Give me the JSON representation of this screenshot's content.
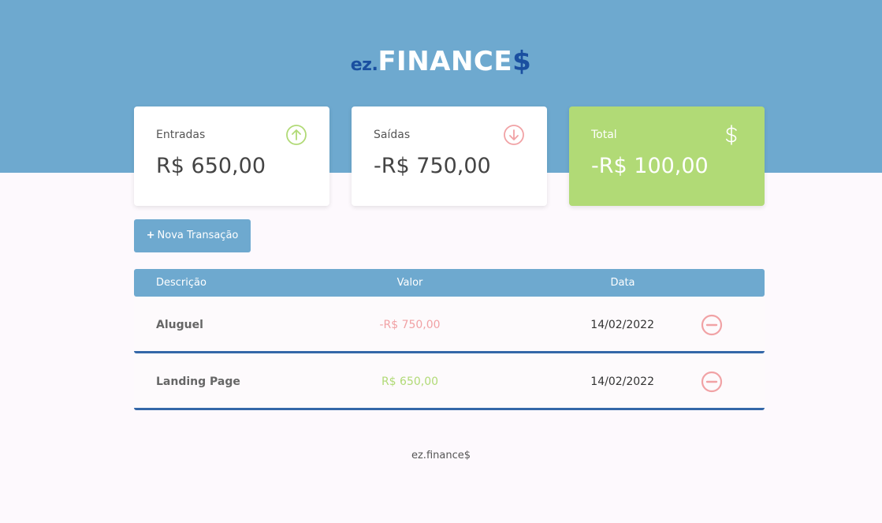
{
  "brand": {
    "prefix": "ez.",
    "name": "FINANCE",
    "suffix": "$"
  },
  "cards": [
    {
      "title": "Entradas",
      "value": "R$ 650,00",
      "icon": "arrow-up-circle-icon",
      "color": "#b1da76"
    },
    {
      "title": "Saídas",
      "value": "-R$ 750,00",
      "icon": "arrow-down-circle-icon",
      "color": "#f1a2a5"
    },
    {
      "title": "Total",
      "value": "-R$ 100,00",
      "icon": "dollar-icon",
      "color": "#ffffff"
    }
  ],
  "new_transaction": {
    "plus": "+",
    "label": "Nova Transação"
  },
  "table": {
    "headers": [
      "Descrição",
      "Valor",
      "Data"
    ],
    "rows": [
      {
        "description": "Aluguel",
        "amount": "-R$ 750,00",
        "date": "14/02/2022",
        "type": "expense"
      },
      {
        "description": "Landing Page",
        "amount": "R$ 650,00",
        "date": "14/02/2022",
        "type": "income"
      }
    ]
  },
  "footer": {
    "text": "ez.finance$"
  },
  "colors": {
    "header_bg": "#6ea9cf",
    "brand_blue": "#1a4fa0",
    "income_green": "#b1da76",
    "expense_red": "#f1a2a5",
    "row_border": "#3467a8",
    "page_bg": "#fdf9fd"
  }
}
